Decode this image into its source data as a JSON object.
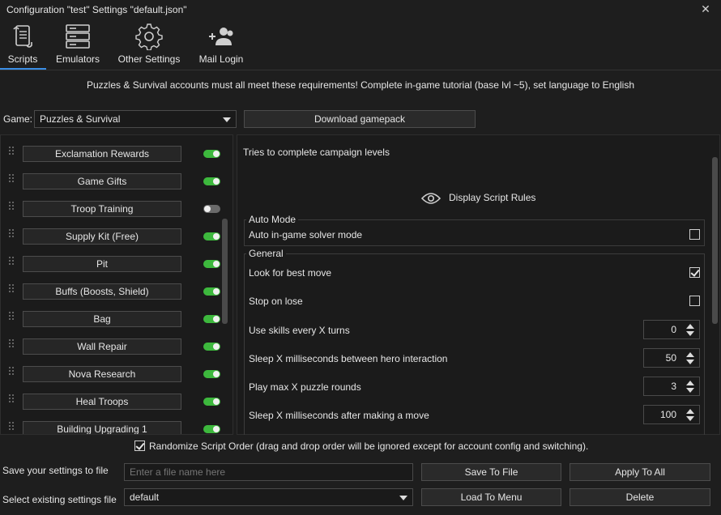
{
  "window": {
    "title": "Configuration \"test\" Settings \"default.json\"",
    "close_glyph": "✕"
  },
  "tabs": [
    {
      "label": "Scripts",
      "icon": "scroll-icon",
      "active": true
    },
    {
      "label": "Emulators",
      "icon": "server-icon",
      "active": false
    },
    {
      "label": "Other Settings",
      "icon": "gear-icon",
      "active": false
    },
    {
      "label": "Mail Login",
      "icon": "add-users-icon",
      "active": false
    }
  ],
  "requirements": "Puzzles & Survival accounts must all meet these requirements! Complete in-game tutorial (base lvl ~5), set language to English",
  "game": {
    "label": "Game:",
    "value": "Puzzles & Survival",
    "download_label": "Download gamepack"
  },
  "scripts": [
    {
      "name": "Exclamation Rewards",
      "enabled": true
    },
    {
      "name": "Game Gifts",
      "enabled": true
    },
    {
      "name": "Troop Training",
      "enabled": false
    },
    {
      "name": "Supply Kit (Free)",
      "enabled": true
    },
    {
      "name": "Pit",
      "enabled": true
    },
    {
      "name": "Buffs (Boosts, Shield)",
      "enabled": true
    },
    {
      "name": "Bag",
      "enabled": true
    },
    {
      "name": "Wall Repair",
      "enabled": true
    },
    {
      "name": "Nova Research",
      "enabled": true
    },
    {
      "name": "Heal Troops",
      "enabled": true
    },
    {
      "name": "Building Upgrading 1",
      "enabled": true
    }
  ],
  "detail": {
    "description": "Tries to complete campaign levels",
    "rules_label": "Display Script Rules",
    "auto_mode": {
      "title": "Auto Mode",
      "solver_label": "Auto in-game solver mode",
      "solver_checked": false
    },
    "general": {
      "title": "General",
      "best_move_label": "Look for best move",
      "best_move_checked": true,
      "stop_lose_label": "Stop on lose",
      "stop_lose_checked": false,
      "skills_label": "Use skills every X turns",
      "skills_value": "0",
      "sleep_hero_label": "Sleep X milliseconds between hero interaction",
      "sleep_hero_value": "50",
      "max_rounds_label": "Play max X puzzle rounds",
      "max_rounds_value": "3",
      "sleep_move_label": "Sleep X milliseconds after making a move",
      "sleep_move_value": "100"
    }
  },
  "randomize": {
    "checked": true,
    "label": "Randomize Script Order (drag and drop order will be ignored except for account config and switching)."
  },
  "save": {
    "label": "Save your settings to file",
    "placeholder": "Enter a file name here",
    "save_button": "Save To File",
    "apply_button": "Apply To All"
  },
  "load": {
    "label": "Select existing settings file",
    "value": "default",
    "load_button": "Load To Menu",
    "delete_button": "Delete"
  },
  "colors": {
    "accent": "#3a8ee6",
    "toggle_on": "#3db83d",
    "toggle_off": "#6a6a6a",
    "background": "#1e1e1e"
  }
}
